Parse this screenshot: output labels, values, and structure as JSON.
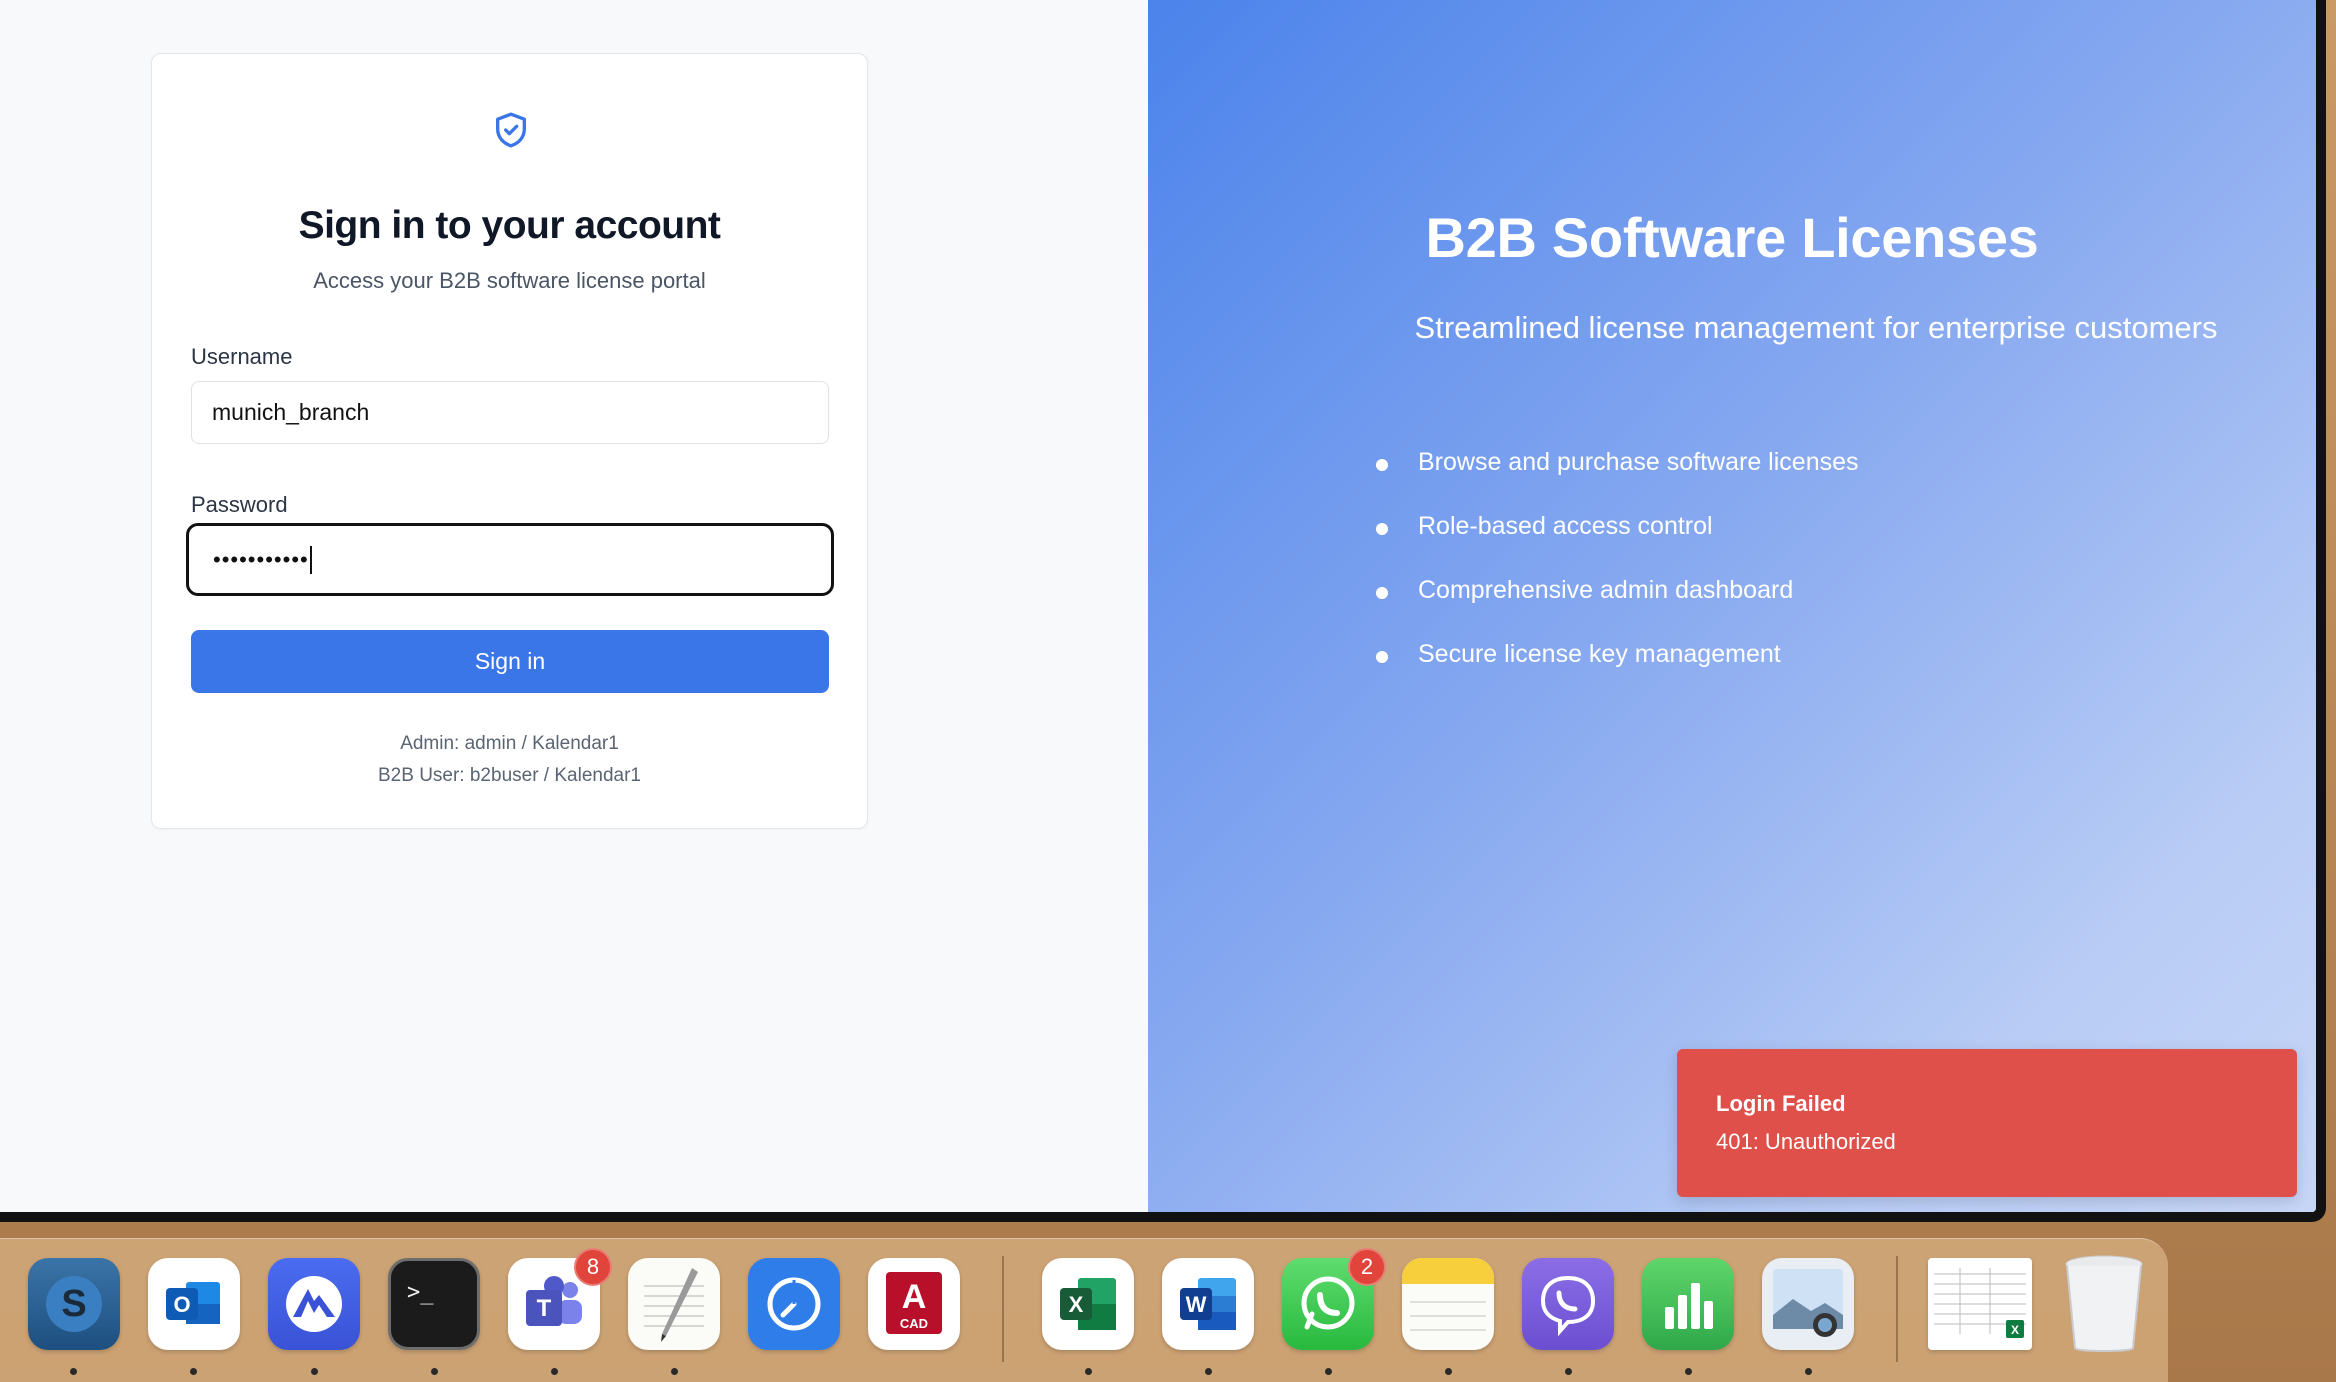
{
  "login": {
    "title": "Sign in to your account",
    "subtitle": "Access your B2B software license portal",
    "username_label": "Username",
    "username_value": "munich_branch",
    "password_label": "Password",
    "password_masked": "•••••••••••",
    "submit_label": "Sign in",
    "hint_admin": "Admin: admin / Kalendar1",
    "hint_b2b": "B2B User: b2buser / Kalendar1"
  },
  "promo": {
    "title": "B2B Software Licenses",
    "subtitle": "Streamlined license management for enterprise customers",
    "features": [
      "Browse and purchase software licenses",
      "Role-based access control",
      "Comprehensive admin dashboard",
      "Secure license key management"
    ]
  },
  "toast": {
    "title": "Login Failed",
    "message": "401: Unauthorized"
  },
  "dock": {
    "badges": {
      "teams": "8",
      "whatsapp": "2"
    },
    "apps": [
      {
        "name": "skype",
        "icon": "skype-icon"
      },
      {
        "name": "outlook",
        "icon": "outlook-icon"
      },
      {
        "name": "nordvpn",
        "icon": "nordvpn-icon"
      },
      {
        "name": "terminal",
        "icon": "terminal-icon"
      },
      {
        "name": "teams",
        "icon": "teams-icon"
      },
      {
        "name": "textedit",
        "icon": "textedit-icon"
      },
      {
        "name": "safari-like",
        "icon": "clock-compass-icon"
      },
      {
        "name": "autocad",
        "icon": "autocad-icon"
      },
      {
        "name": "excel",
        "icon": "excel-icon"
      },
      {
        "name": "word",
        "icon": "word-icon"
      },
      {
        "name": "whatsapp",
        "icon": "whatsapp-icon"
      },
      {
        "name": "notes",
        "icon": "notes-icon"
      },
      {
        "name": "viber",
        "icon": "viber-icon"
      },
      {
        "name": "numbers",
        "icon": "numbers-icon"
      },
      {
        "name": "preview",
        "icon": "preview-icon"
      },
      {
        "name": "spreadsheet-doc",
        "icon": "document-thumbnail-icon"
      },
      {
        "name": "trash",
        "icon": "trash-icon"
      }
    ]
  },
  "colors": {
    "primary": "#3b76e8",
    "toast_error": "#df504b",
    "promo_gradient_start": "#4b83eb",
    "promo_gradient_end": "#c7d6f7"
  }
}
